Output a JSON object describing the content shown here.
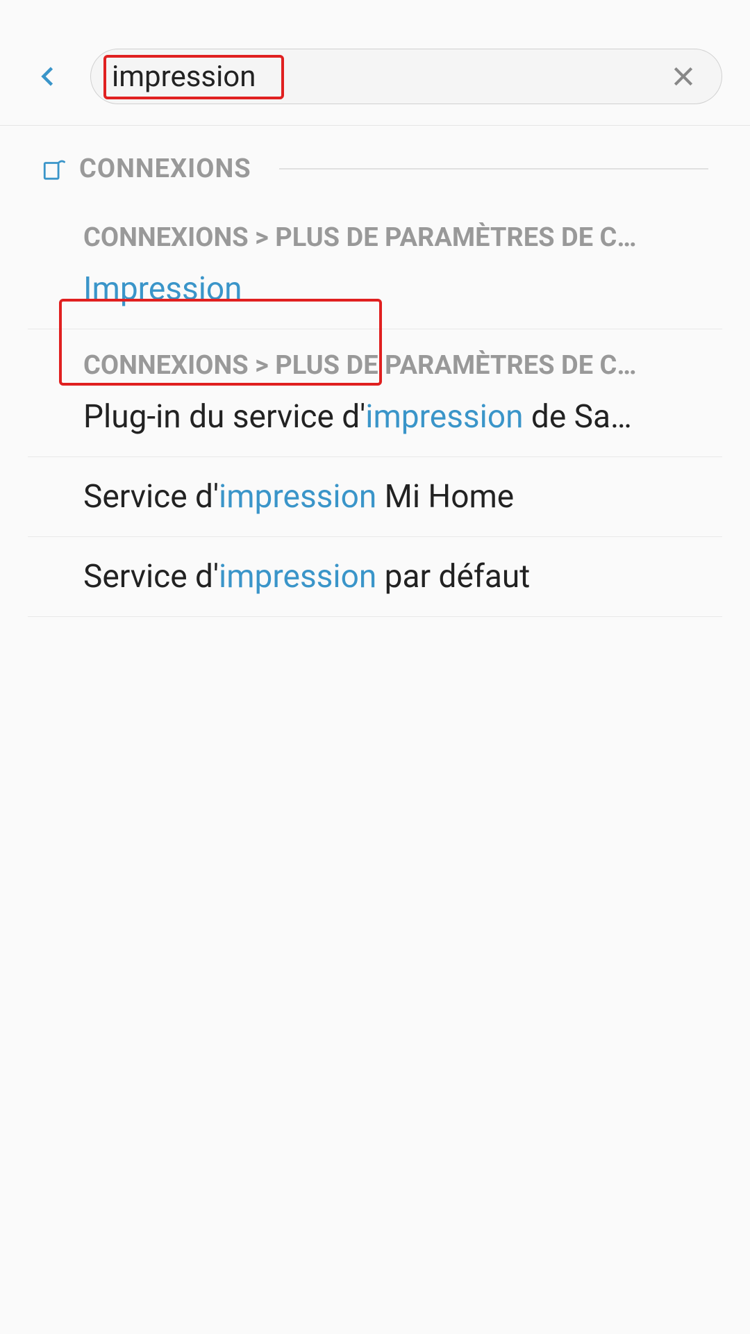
{
  "search": {
    "value": "impression"
  },
  "section": {
    "title": "CONNEXIONS"
  },
  "results": [
    {
      "breadcrumb": "CONNEXIONS > PLUS DE PARAMÈTRES DE C…",
      "title_parts": [
        {
          "text": "Impression",
          "highlight": true
        }
      ]
    },
    {
      "breadcrumb": "CONNEXIONS > PLUS DE PARAMÈTRES DE C…",
      "title_parts": [
        {
          "text": "Plug-in du service d'",
          "highlight": false
        },
        {
          "text": "impression",
          "highlight": true
        },
        {
          "text": " de Sa…",
          "highlight": false
        }
      ]
    },
    {
      "breadcrumb": "",
      "title_parts": [
        {
          "text": "Service d'",
          "highlight": false
        },
        {
          "text": "impression",
          "highlight": true
        },
        {
          "text": " Mi Home",
          "highlight": false
        }
      ]
    },
    {
      "breadcrumb": "",
      "title_parts": [
        {
          "text": "Service d'",
          "highlight": false
        },
        {
          "text": "impression",
          "highlight": true
        },
        {
          "text": " par défaut",
          "highlight": false
        }
      ]
    }
  ]
}
